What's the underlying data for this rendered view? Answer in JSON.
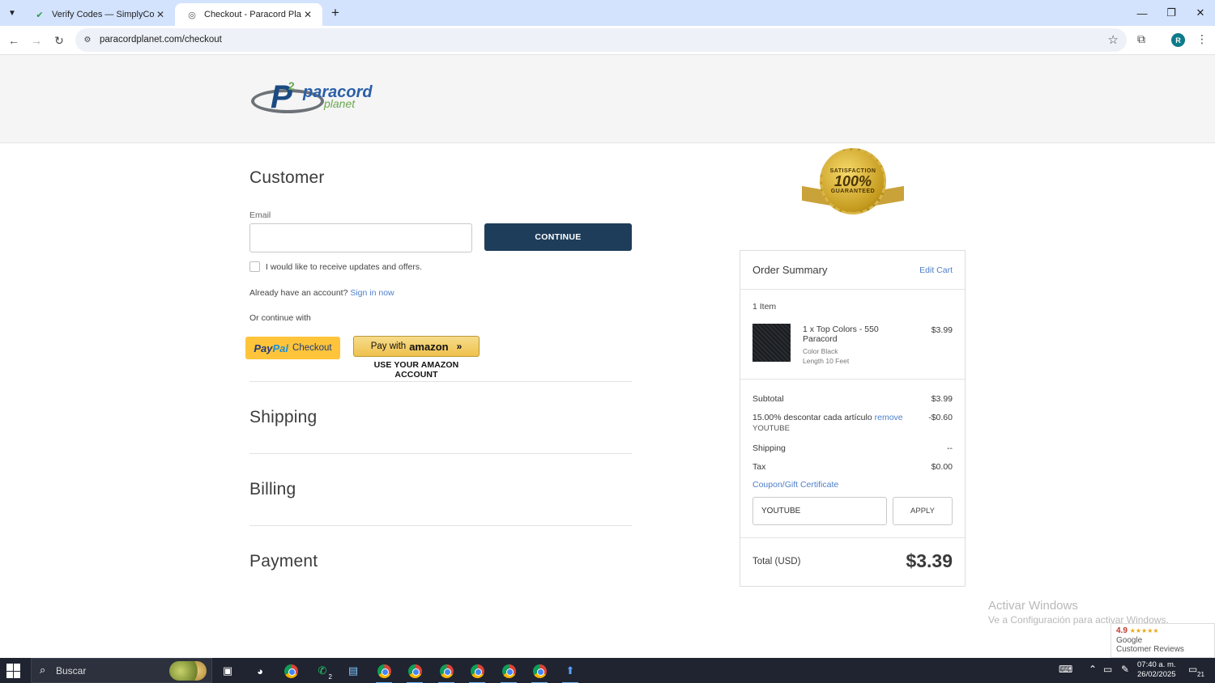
{
  "browser": {
    "tabs": [
      {
        "title": "Verify Codes — SimplyCodes",
        "active": false
      },
      {
        "title": "Checkout - Paracord Planet",
        "active": true
      }
    ],
    "url": "paracordplanet.com/checkout",
    "profile_initial": "R"
  },
  "logo": {
    "letter": "P",
    "superscript": "2",
    "brand_top": "paracord",
    "brand_bottom": "planet"
  },
  "customer": {
    "title": "Customer",
    "email_label": "Email",
    "email_value": "",
    "continue_label": "CONTINUE",
    "updates_checkbox_label": "I would like to receive updates and offers.",
    "updates_checked": false,
    "account_prompt": "Already have an account?",
    "sign_in_link": "Sign in now",
    "or_continue": "Or continue with",
    "paypal": {
      "pay": "Pay",
      "pal": "Pal",
      "checkout": "Checkout"
    },
    "amazon": {
      "pay_with": "Pay with",
      "brand": "amazon",
      "subtitle": "USE YOUR AMAZON ACCOUNT"
    }
  },
  "sections": {
    "shipping": "Shipping",
    "billing": "Billing",
    "payment": "Payment"
  },
  "seal": {
    "top": "SATISFACTION",
    "big": "100%",
    "bottom": "GUARANTEED"
  },
  "order_summary": {
    "title": "Order Summary",
    "edit_cart": "Edit Cart",
    "item_count": "1 Item",
    "item": {
      "name": "1 x Top Colors - 550 Paracord",
      "options": [
        "Color Black",
        "Length 10 Feet"
      ],
      "price": "$3.99"
    },
    "subtotal_label": "Subtotal",
    "subtotal_value": "$3.99",
    "discount_label": "15.00% descontar cada artículo",
    "discount_remove": "remove",
    "discount_code": "YOUTUBE",
    "discount_value": "-$0.60",
    "shipping_label": "Shipping",
    "shipping_value": "--",
    "tax_label": "Tax",
    "tax_value": "$0.00",
    "coupon_link": "Coupon/Gift Certificate",
    "coupon_value": "YOUTUBE",
    "apply_label": "APPLY",
    "total_label": "Total (USD)",
    "total_value": "$3.39"
  },
  "overlay": {
    "activate_title": "Activar Windows",
    "activate_sub": "Ve a Configuración para activar Windows.",
    "reviews_rating": "4.9",
    "reviews_stars": "★★★★★",
    "reviews_brand": "Google",
    "reviews_label": "Customer Reviews"
  },
  "taskbar": {
    "search_placeholder": "Buscar",
    "whatsapp_badge": "2",
    "time": "07:40 a. m.",
    "date": "26/02/2025",
    "notification_count": "21"
  },
  "colors": {
    "primary_button": "#1e3d5a",
    "link": "#4d7fc9",
    "paypal": "#ffc43a",
    "tabstrip": "#d3e3fd"
  }
}
